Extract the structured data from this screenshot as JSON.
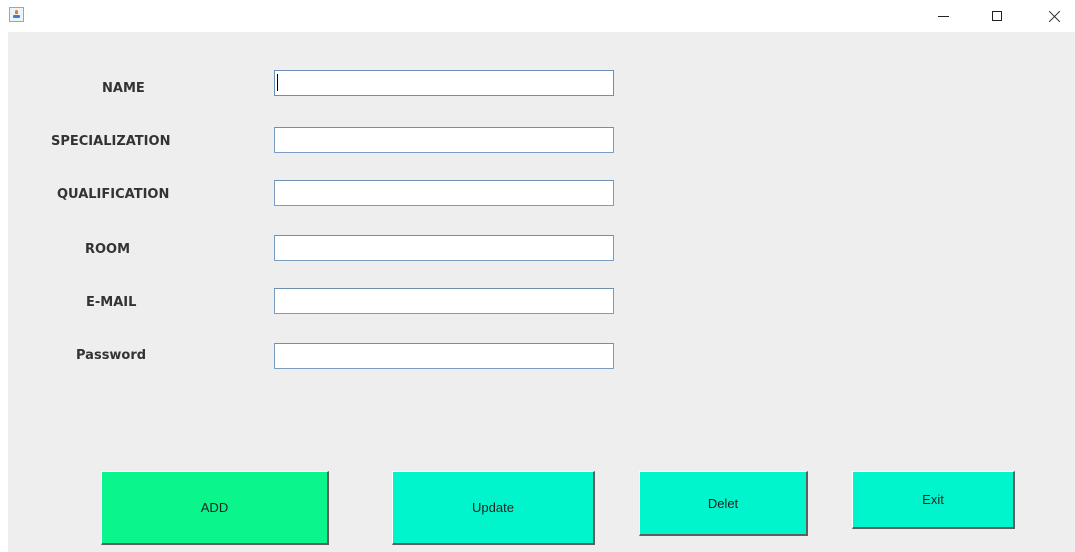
{
  "window": {
    "title": "",
    "controls": {
      "minimize": "minimize-icon",
      "maximize": "maximize-icon",
      "close": "close-icon"
    }
  },
  "form": {
    "fields": [
      {
        "label": "NAME",
        "value": "",
        "placeholder": ""
      },
      {
        "label": "SPECIALIZATION",
        "value": "",
        "placeholder": ""
      },
      {
        "label": "QUALIFICATION",
        "value": "",
        "placeholder": ""
      },
      {
        "label": "ROOM",
        "value": "",
        "placeholder": ""
      },
      {
        "label": "E-MAIL",
        "value": "",
        "placeholder": ""
      },
      {
        "label": "Password",
        "value": "",
        "placeholder": ""
      }
    ]
  },
  "buttons": {
    "add": {
      "label": "ADD",
      "color": "#0af58c"
    },
    "update": {
      "label": "Update",
      "color": "#00f5cc"
    },
    "delete": {
      "label": "Delet",
      "color": "#00f5cc"
    },
    "exit": {
      "label": "Exit",
      "color": "#00f5cc"
    }
  },
  "colors": {
    "background": "#eeeeee",
    "field_border": "#7a9cbf"
  }
}
